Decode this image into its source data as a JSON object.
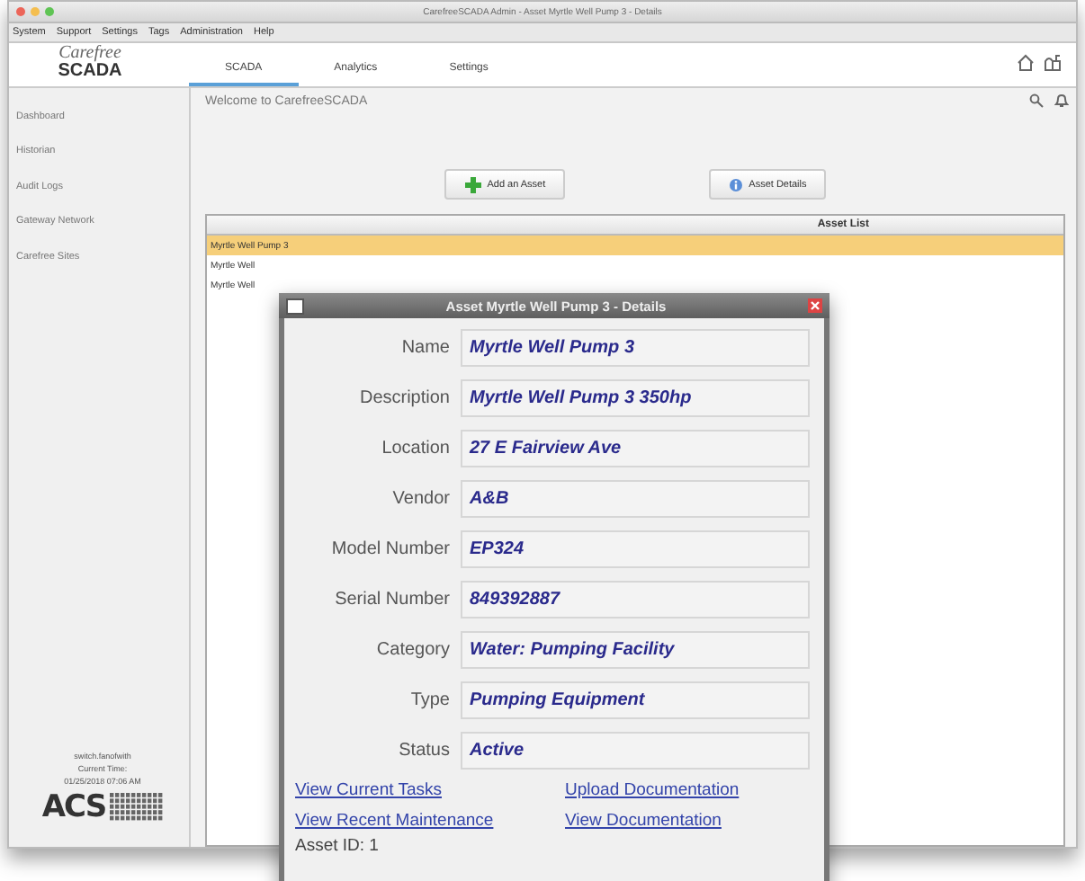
{
  "window": {
    "title": "CarefreeSCADA Admin - Asset Myrtle Well Pump 3 - Details"
  },
  "menu": [
    "System",
    "Support",
    "Settings",
    "Tags",
    "Administration",
    "Help"
  ],
  "logo": {
    "script": "Carefree",
    "word": "SCADA"
  },
  "tabs": [
    {
      "label": "SCADA",
      "selected": true
    },
    {
      "label": "Analytics",
      "selected": false
    },
    {
      "label": "Settings",
      "selected": false
    }
  ],
  "sidebar": {
    "items": [
      "Dashboard",
      "Historian",
      "Audit Logs",
      "Gateway Network",
      "Carefree Sites"
    ],
    "user": "switch.fanofwith",
    "time_label": "Current Time:",
    "time": "01/25/2018 07:06 AM",
    "brand": "ACS"
  },
  "welcome": "Welcome to CarefreeSCADA",
  "buttons": [
    {
      "label": "Add an Asset",
      "kind": "add"
    },
    {
      "label": "Asset Details",
      "kind": "info"
    }
  ],
  "asset_list": {
    "title": "Asset List",
    "rows": [
      {
        "name": "Myrtle Well Pump 3",
        "selected": true
      },
      {
        "name": "Myrtle Well",
        "selected": false
      },
      {
        "name": "Myrtle Well",
        "selected": false
      }
    ]
  },
  "dialog": {
    "title": "Asset Myrtle Well Pump 3 - Details",
    "fields": [
      {
        "label": "Name",
        "value": "Myrtle Well Pump 3"
      },
      {
        "label": "Description",
        "value": "Myrtle Well Pump 3 350hp"
      },
      {
        "label": "Location",
        "value": "27 E Fairview Ave"
      },
      {
        "label": "Vendor",
        "value": "A&B"
      },
      {
        "label": "Model Number",
        "value": "EP324"
      },
      {
        "label": "Serial Number",
        "value": "849392887"
      },
      {
        "label": "Category",
        "value": "Water: Pumping Facility"
      },
      {
        "label": "Type",
        "value": "Pumping Equipment"
      },
      {
        "label": "Status",
        "value": "Active"
      }
    ],
    "links": [
      "View Current Tasks",
      "Upload Documentation",
      "View Recent Maintenance",
      "View Documentation"
    ],
    "asset_id": "Asset ID: 1"
  }
}
